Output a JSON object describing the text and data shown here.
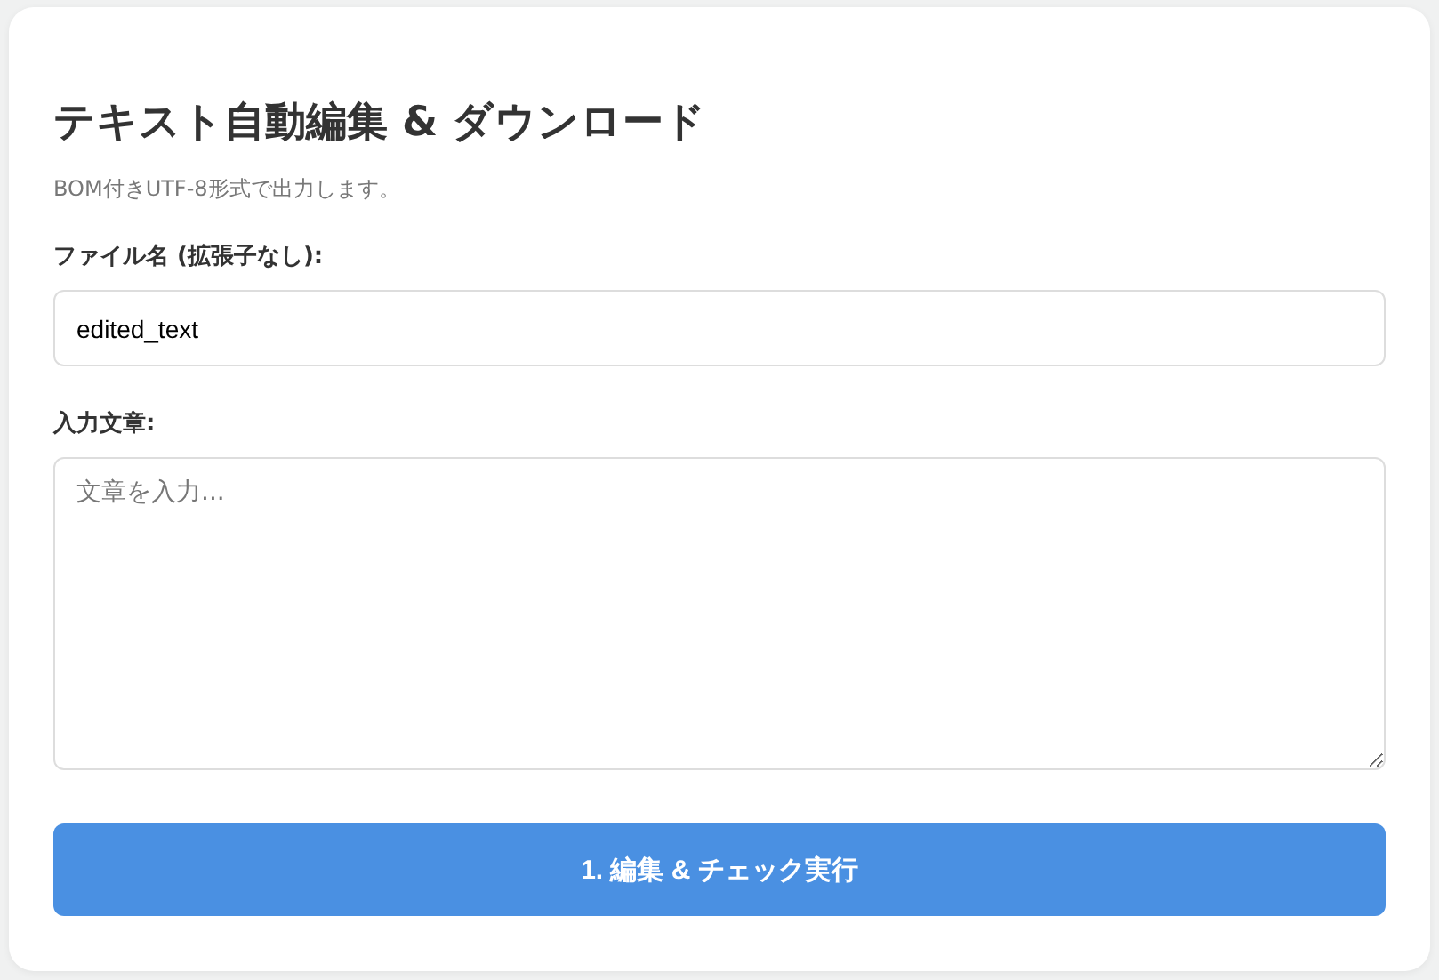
{
  "title": "テキスト自動編集 & ダウンロード",
  "subtitle": "BOM付きUTF-8形式で出力します。",
  "filename": {
    "label": "ファイル名 (拡張子なし):",
    "value": "edited_text"
  },
  "text_input": {
    "label": "入力文章:",
    "placeholder": "文章を入力..."
  },
  "button": "1. 編集 & チェック実行"
}
